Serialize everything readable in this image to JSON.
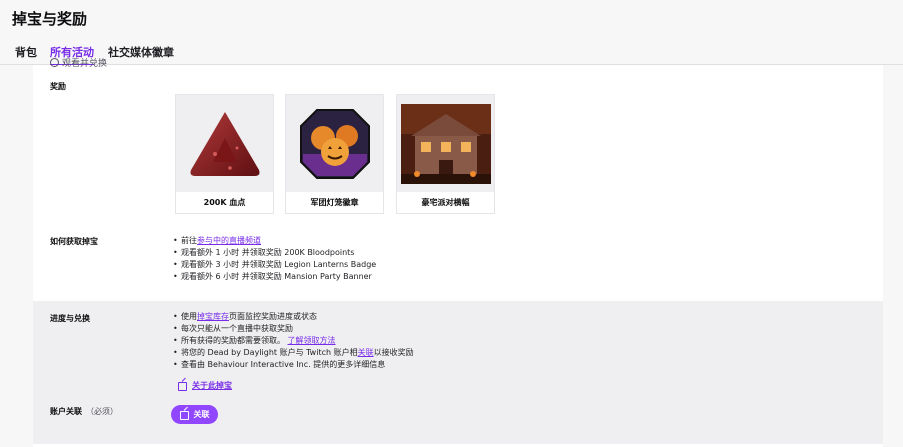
{
  "page": {
    "title": "掉宝与奖励"
  },
  "tabs": [
    {
      "label": "背包"
    },
    {
      "label": "所有活动"
    },
    {
      "label": "社交媒体徽章"
    }
  ],
  "peek_text": "观看并兑换",
  "rewards": {
    "label": "奖励",
    "items": [
      {
        "name": "200K 血点",
        "icon": "bloodpoints-triangle-icon"
      },
      {
        "name": "军团灯笼徽章",
        "icon": "pumpkin-lanterns-icon"
      },
      {
        "name": "豪宅派对横幅",
        "icon": "mansion-banner-icon"
      }
    ]
  },
  "how_to": {
    "label": "如何获取掉宝",
    "go_prefix": "前往",
    "go_link": "参与中的直播频道",
    "steps": [
      "观看额外 1 小时 并领取奖励 200K Bloodpoints",
      "观看额外 3 小时 并领取奖励 Legion Lanterns Badge",
      "观看额外 6 小时 并领取奖励 Mansion Party Banner"
    ]
  },
  "progress": {
    "label": "进度与兑换",
    "b1_prefix": "使用",
    "b1_link": "掉宝库存",
    "b1_suffix": "页面监控奖励进度或状态",
    "b2": "每次只能从一个直播中获取奖励",
    "b3_text": "所有获得的奖励都需要领取。",
    "b3_link": "了解领取方法",
    "b4_prefix": "将您的 Dead by Daylight 账户与 Twitch 账户相",
    "b4_link": "关联",
    "b4_suffix": "以接收奖励",
    "b5": "查看由 Behaviour Interactive Inc. 提供的更多详细信息",
    "about_link": "关于此掉宝"
  },
  "account": {
    "label": "账户关联",
    "required": "（必须）",
    "button": "关联"
  },
  "colors": {
    "accent": "#772ce8",
    "button": "#9147ff",
    "progress_bg": "#efeff1"
  }
}
